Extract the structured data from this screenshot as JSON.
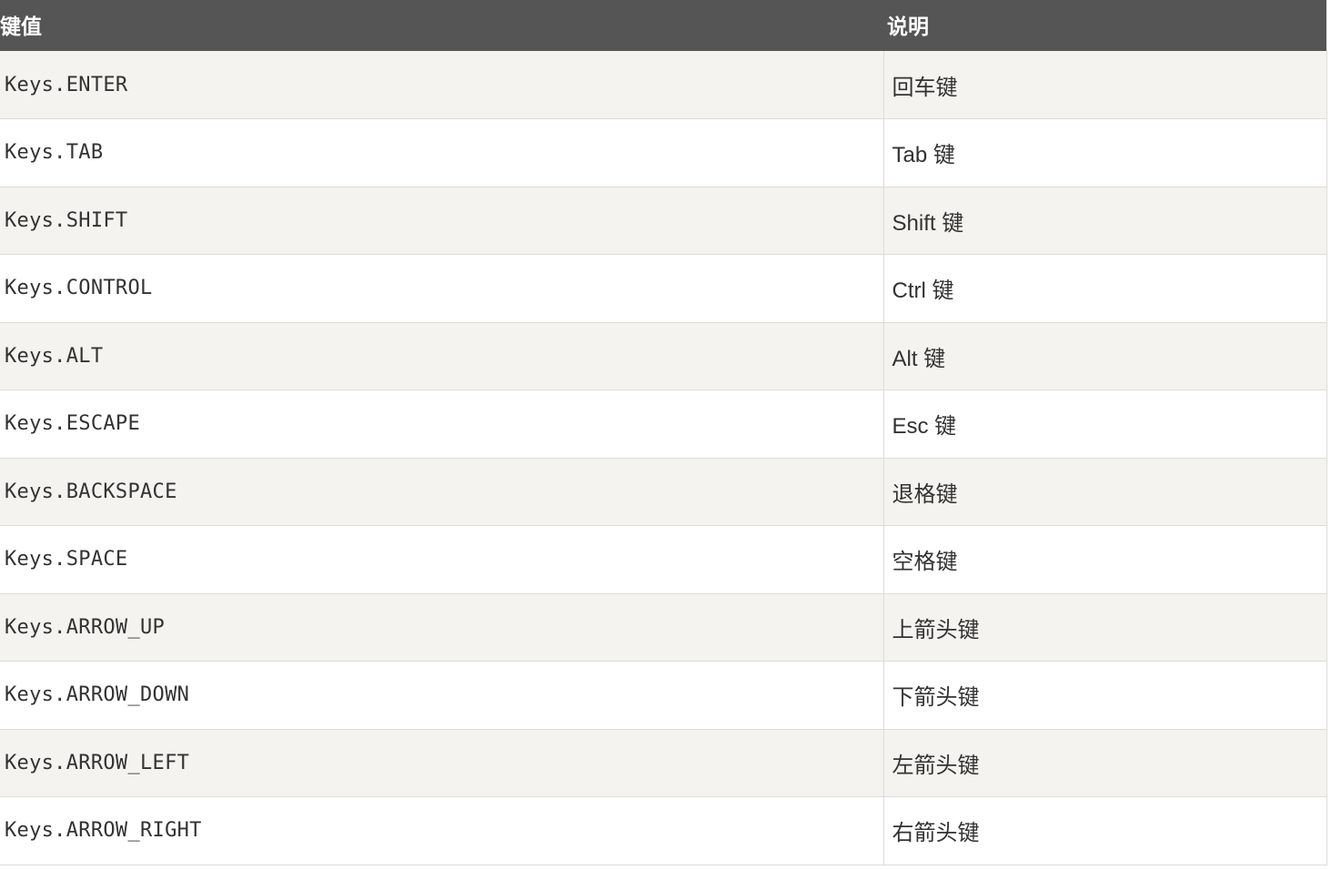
{
  "colors": {
    "header_bg": "#555555",
    "header_text": "#ffffff",
    "row_odd_bg": "#f4f3ef",
    "row_even_bg": "#ffffff",
    "border": "#dcdcdc",
    "text": "#333333"
  },
  "table": {
    "headers": {
      "key": "键值",
      "description": "说明"
    },
    "rows": [
      {
        "key": "Keys.ENTER",
        "description": "回车键"
      },
      {
        "key": "Keys.TAB",
        "description": "Tab 键"
      },
      {
        "key": "Keys.SHIFT",
        "description": "Shift 键"
      },
      {
        "key": "Keys.CONTROL",
        "description": "Ctrl 键"
      },
      {
        "key": "Keys.ALT",
        "description": "Alt 键"
      },
      {
        "key": "Keys.ESCAPE",
        "description": "Esc 键"
      },
      {
        "key": "Keys.BACKSPACE",
        "description": "退格键"
      },
      {
        "key": "Keys.SPACE",
        "description": "空格键"
      },
      {
        "key": "Keys.ARROW_UP",
        "description": "上箭头键"
      },
      {
        "key": "Keys.ARROW_DOWN",
        "description": "下箭头键"
      },
      {
        "key": "Keys.ARROW_LEFT",
        "description": "左箭头键"
      },
      {
        "key": "Keys.ARROW_RIGHT",
        "description": "右箭头键"
      }
    ]
  }
}
